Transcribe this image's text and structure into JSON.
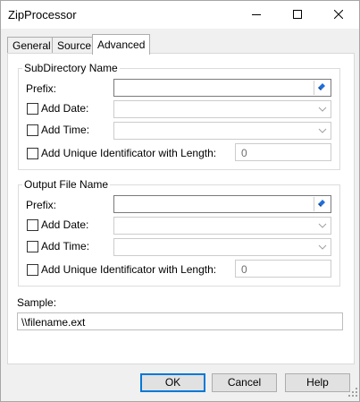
{
  "window": {
    "title": "ZipProcessor",
    "controls": {
      "minimize": "minimize-icon",
      "maximize": "maximize-icon",
      "close": "close-icon"
    }
  },
  "tabs": [
    {
      "label": "General"
    },
    {
      "label": "Source"
    },
    {
      "label": "Advanced"
    }
  ],
  "subdirectory": {
    "legend": "SubDirectory Name",
    "prefix_label": "Prefix:",
    "prefix_value": "",
    "add_date_label": "Add Date:",
    "add_date_value": "",
    "add_time_label": "Add Time:",
    "add_time_value": "",
    "unique_label": "Add Unique Identificator with Length:",
    "unique_value": "0"
  },
  "output": {
    "legend": "Output File Name",
    "prefix_label": "Prefix:",
    "prefix_value": "",
    "add_date_label": "Add Date:",
    "add_date_value": "",
    "add_time_label": "Add Time:",
    "add_time_value": "",
    "unique_label": "Add Unique Identificator with Length:",
    "unique_value": "0"
  },
  "sample": {
    "label": "Sample:",
    "value": "\\\\filename.ext"
  },
  "buttons": {
    "ok": "OK",
    "cancel": "Cancel",
    "help": "Help"
  },
  "colors": {
    "accent": "#0078d7",
    "picker_icon": "#1e6fd9"
  }
}
